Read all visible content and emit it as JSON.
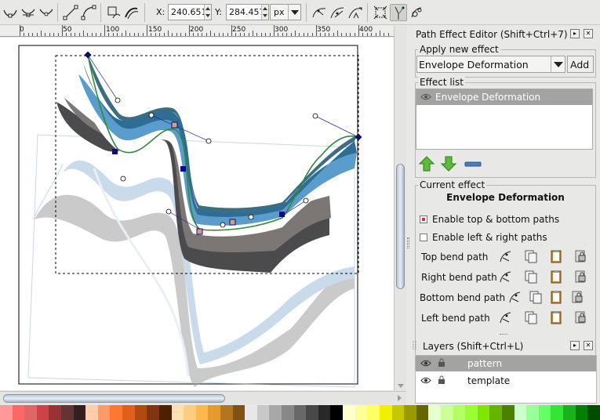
{
  "toolbar": {
    "x_label": "X:",
    "x_value": "240.651",
    "y_label": "Y:",
    "y_value": "284.457",
    "unit": "px",
    "icons": [
      "node-cusp-icon",
      "node-smooth-icon",
      "node-symmetric-icon",
      "segment-to-line-icon",
      "segment-to-curve-icon",
      "object-to-path-icon",
      "stroke-to-path-icon",
      "show-handles-icon",
      "show-outline-icon",
      "show-transform-icon",
      "show-clippath-icon",
      "show-lpe-handles-icon",
      "edit-next-lpe-param-icon"
    ]
  },
  "ruler": {
    "labels": [
      "0",
      "50",
      "100",
      "150",
      "200",
      "250",
      "300",
      "350",
      "400"
    ]
  },
  "panel": {
    "title": "Path Effect Editor (Shift+Ctrl+7)",
    "apply_new_label": "Apply new effect",
    "effect_select_value": "Envelope Deformation",
    "add_button": "Add",
    "effect_list_label": "Effect list",
    "effect_list_items": [
      "Envelope Deformation"
    ],
    "current_effect_label": "Current effect",
    "current_effect_name": "Envelope Deformation",
    "enable_top_bottom": "Enable top & bottom paths",
    "enable_left_right": "Enable left & right paths",
    "top_bottom_checked": true,
    "left_right_checked": false,
    "bend_paths": [
      {
        "label": "Top bend path"
      },
      {
        "label": "Right bend path"
      },
      {
        "label": "Bottom bend path"
      },
      {
        "label": "Left bend path"
      }
    ]
  },
  "layers": {
    "title": "Layers (Shift+Ctrl+L)",
    "items": [
      {
        "name": "pattern",
        "selected": true
      },
      {
        "name": "template",
        "selected": false
      }
    ]
  },
  "colors": {
    "accent_blue": "#4f8fc0",
    "dark_grey": "#4a4a4a",
    "selection_row": "#a3a3a1",
    "path_green": "#2f8a3a"
  },
  "palette": [
    "#ff9999",
    "#ff6666",
    "#e06666",
    "#cc4444",
    "#993333",
    "#663333",
    "#331f1f",
    "#ffccaa",
    "#ff9966",
    "#ff7733",
    "#e0601a",
    "#b04a10",
    "#803510",
    "#4d2000",
    "#ffe0b0",
    "#ffcc80",
    "#ffb84d",
    "#e69a2e",
    "#b37520",
    "#805216",
    "#e8e8e8",
    "#c8c8c8",
    "#a8a8a8",
    "#888888",
    "#686868",
    "#484848",
    "#282828",
    "#000000",
    "#ffffcc",
    "#ffff99",
    "#ffff66",
    "#f0f000",
    "#c8c800",
    "#999900",
    "#666600",
    "#e6ffcc",
    "#ccff99",
    "#b3ff66",
    "#99ff33",
    "#80e600",
    "#66b300",
    "#4d8000",
    "#ccffcc",
    "#99ff99",
    "#66ff66",
    "#33e633",
    "#19b319",
    "#008000",
    "#004d00"
  ]
}
